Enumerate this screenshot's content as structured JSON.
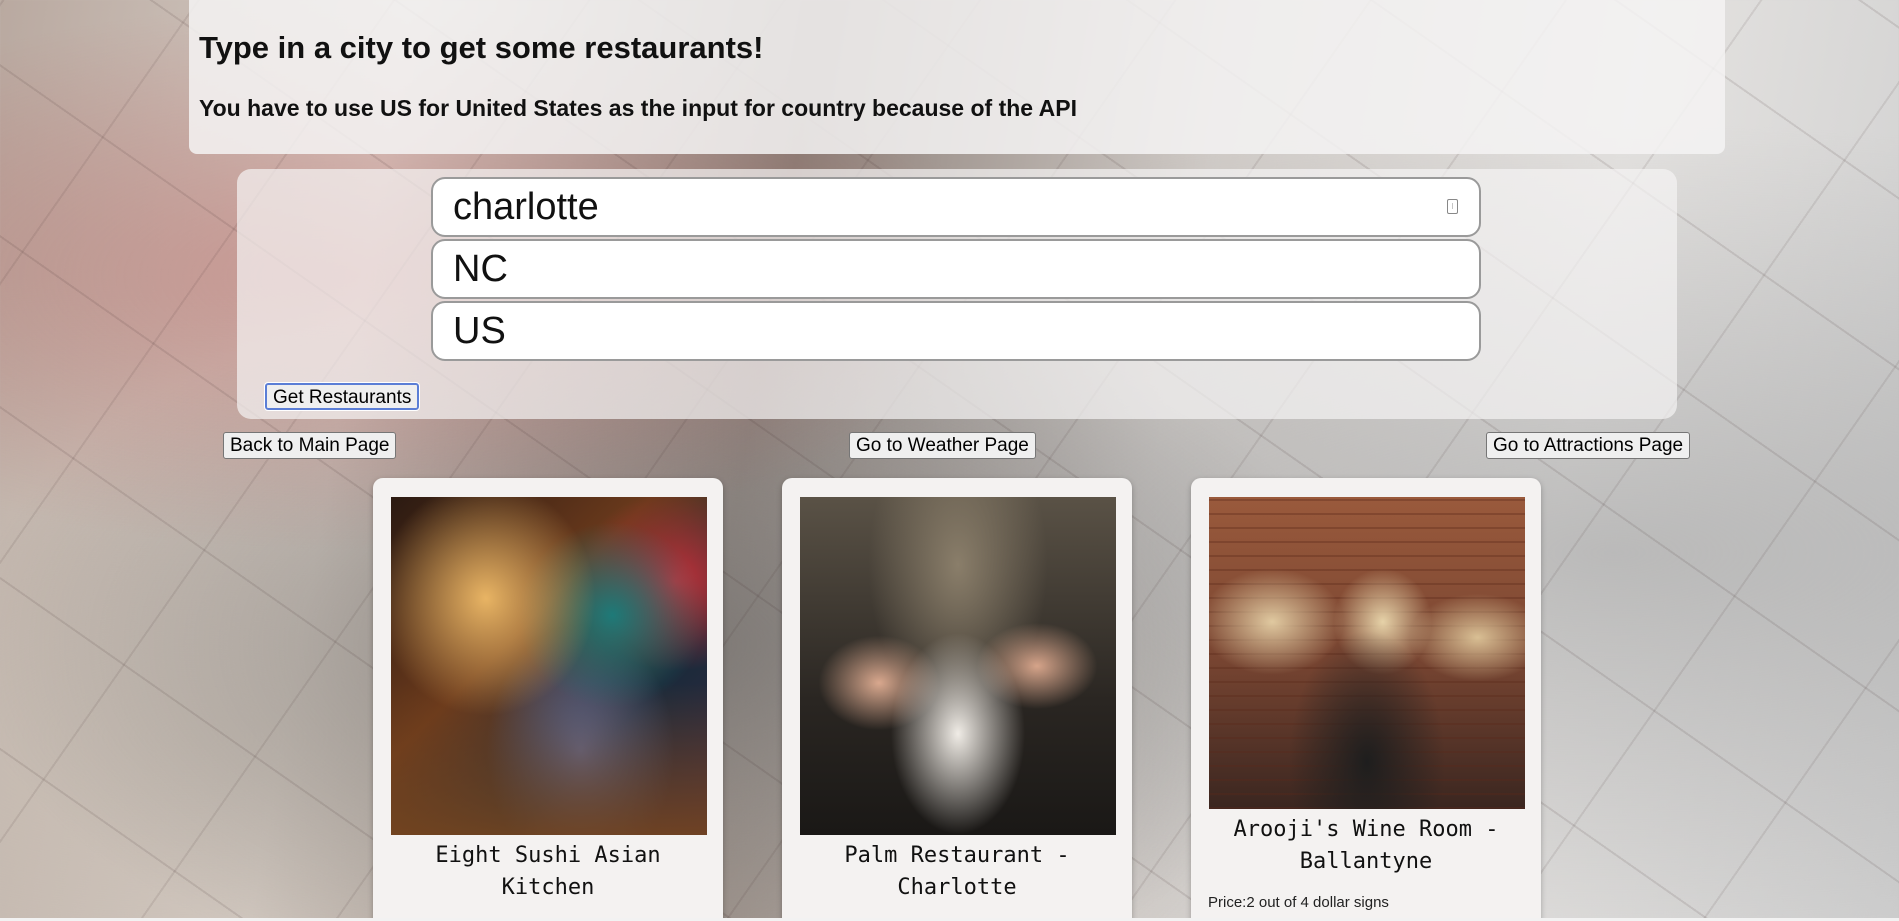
{
  "header": {
    "title": "Type in a city to get some restaurants!",
    "subtitle": "You have to use US for United States as the input for country because of the API"
  },
  "form": {
    "city_value": "charlotte",
    "state_value": "NC",
    "country_value": "US",
    "submit_label": "Get Restaurants"
  },
  "nav": {
    "back_label": "Back to Main Page",
    "weather_label": "Go to Weather Page",
    "attractions_label": "Go to Attractions Page"
  },
  "restaurants": [
    {
      "name": "Eight Sushi Asian Kitchen",
      "image": "restaurant-photo"
    },
    {
      "name": "Palm Restaurant - Charlotte",
      "image": "restaurant-photo"
    },
    {
      "name": "Arooji's Wine Room - Ballantyne",
      "image": "restaurant-photo",
      "price": "Price:2 out of 4 dollar signs"
    }
  ],
  "colors": {
    "panel": "#f5f3f3",
    "focus_ring": "#5b7ed6"
  }
}
